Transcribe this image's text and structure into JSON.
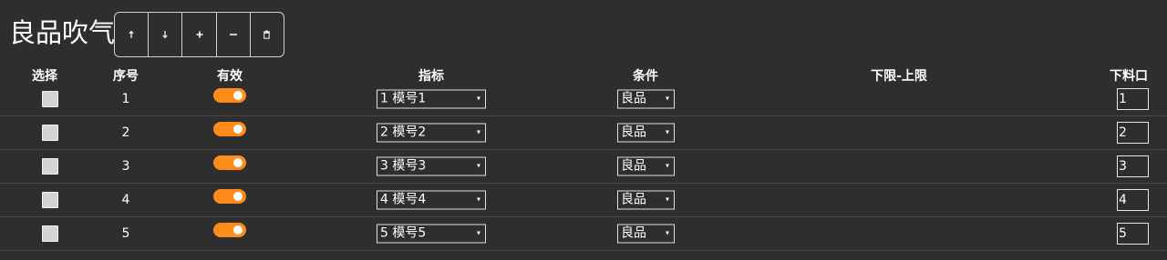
{
  "title": "良品吹气",
  "toolbar": {
    "buttons": [
      {
        "icon": "arrow-up-icon"
      },
      {
        "icon": "arrow-down-icon"
      },
      {
        "icon": "plus-icon"
      },
      {
        "icon": "minus-icon"
      },
      {
        "icon": "trash-icon"
      }
    ]
  },
  "columns": {
    "select": "选择",
    "index": "序号",
    "enabled": "有效",
    "metric": "指标",
    "condition": "条件",
    "range": "下限-上限",
    "outlet": "下料口"
  },
  "rows": [
    {
      "index": "1",
      "enabled": true,
      "metric": "1 模号1",
      "condition": "良品",
      "outlet": "1"
    },
    {
      "index": "2",
      "enabled": true,
      "metric": "2 模号2",
      "condition": "良品",
      "outlet": "2"
    },
    {
      "index": "3",
      "enabled": true,
      "metric": "3 模号3",
      "condition": "良品",
      "outlet": "3"
    },
    {
      "index": "4",
      "enabled": true,
      "metric": "4 模号4",
      "condition": "良品",
      "outlet": "4"
    },
    {
      "index": "5",
      "enabled": true,
      "metric": "5 模号5",
      "condition": "良品",
      "outlet": "5"
    }
  ],
  "colors": {
    "background": "#2e2e2e",
    "toggle_on": "#ff8c1a",
    "text": "#ffffff"
  }
}
